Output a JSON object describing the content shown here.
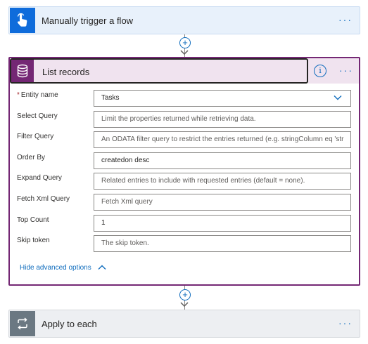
{
  "trigger": {
    "title": "Manually trigger a flow",
    "icon": "touch-hand-icon",
    "more": "···"
  },
  "list_records": {
    "title": "List records",
    "icon": "database-icon",
    "info": "i",
    "more": "···",
    "fields": [
      {
        "label": "Entity name",
        "required_mark": "*",
        "value": "Tasks",
        "is_placeholder": false
      },
      {
        "label": "Select Query",
        "value": "Limit the properties returned while retrieving data.",
        "is_placeholder": true
      },
      {
        "label": "Filter Query",
        "value": "An ODATA filter query to restrict the entries returned (e.g. stringColumn eq 'str",
        "is_placeholder": true
      },
      {
        "label": "Order By",
        "value": "createdon desc",
        "is_placeholder": false
      },
      {
        "label": "Expand Query",
        "value": "Related entries to include with requested entries (default = none).",
        "is_placeholder": true
      },
      {
        "label": "Fetch Xml Query",
        "value": "Fetch Xml query",
        "is_placeholder": true
      },
      {
        "label": "Top Count",
        "value": "1",
        "is_placeholder": false
      },
      {
        "label": "Skip token",
        "value": "The skip token.",
        "is_placeholder": true
      }
    ],
    "advanced_link": "Hide advanced options"
  },
  "apply": {
    "title": "Apply to each",
    "icon": "loop-icon",
    "more": "···"
  },
  "connector_plus": "+",
  "colors": {
    "trigger_blue": "#0f6cdb",
    "dataverse_purple": "#742774",
    "link_blue": "#0f6cbd",
    "control_gray": "#6b7882"
  }
}
